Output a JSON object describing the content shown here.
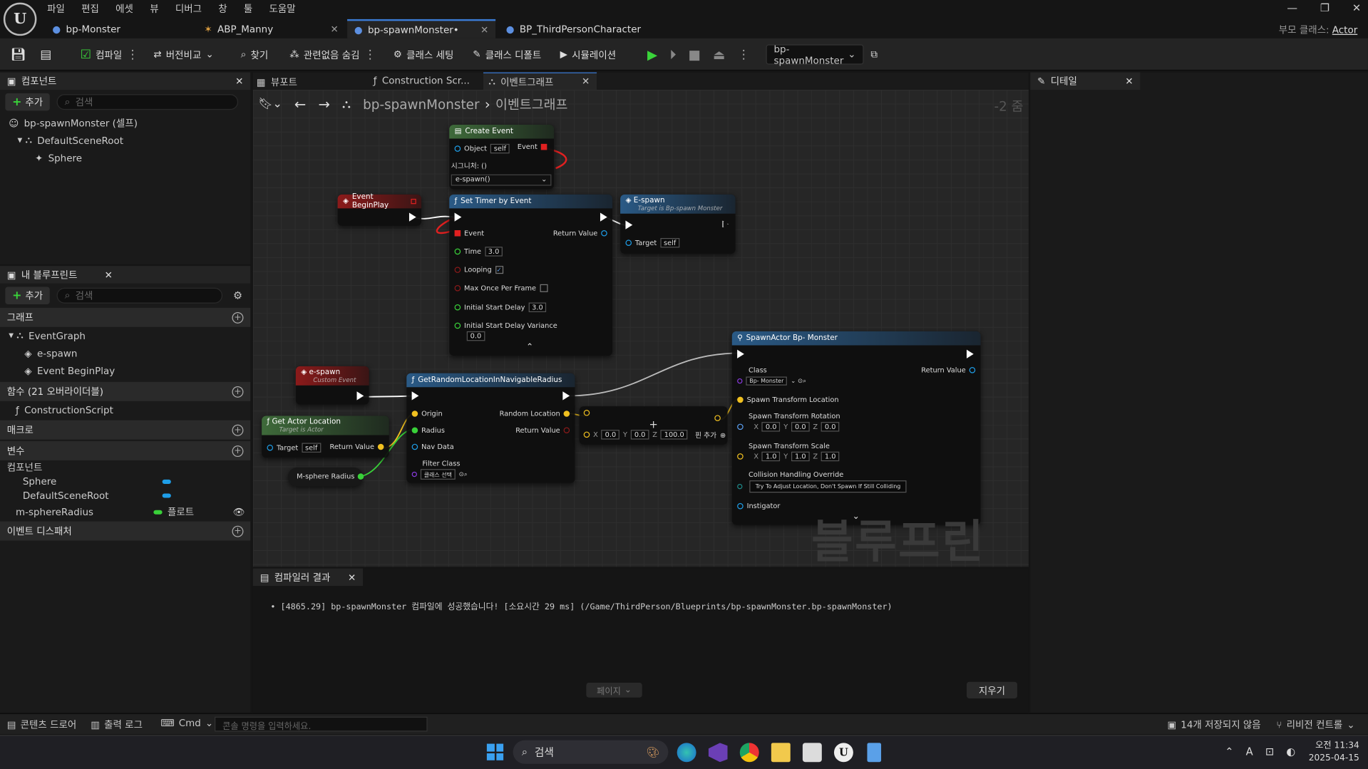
{
  "menu": [
    "파일",
    "편집",
    "에셋",
    "뷰",
    "디버그",
    "창",
    "툴",
    "도움말"
  ],
  "doc_tabs": [
    {
      "label": "bp-Monster"
    },
    {
      "label": "ABP_Manny"
    },
    {
      "label": "bp-spawnMonster•"
    },
    {
      "label": "BP_ThirdPersonCharacter"
    }
  ],
  "parent_class": {
    "label": "부모 클래스:",
    "value": "Actor"
  },
  "toolbar": {
    "compile": "컴파일",
    "diff": "버전비교",
    "find": "찾기",
    "hide_unrelated": "관련없음 숨김",
    "class_settings": "클래스 세팅",
    "class_defaults": "클래스 디폴트",
    "simulation": "시뮬레이션",
    "debug_object": "bp-spawnMonster"
  },
  "components": {
    "tab": "컴포넌트",
    "add": "추가",
    "search_placeholder": "검색",
    "items": [
      "bp-spawnMonster (셀프)",
      "DefaultSceneRoot",
      "Sphere"
    ]
  },
  "my_blueprint": {
    "tab": "내 블루프린트",
    "add": "추가",
    "search_placeholder": "검색",
    "graphs_header": "그래프",
    "event_graph": "EventGraph",
    "events": [
      "e-spawn",
      "Event BeginPlay"
    ],
    "functions_header": "함수 (21 오버라이더블)",
    "functions": [
      "ConstructionScript"
    ],
    "macros_header": "매크로",
    "variables_header": "변수",
    "components_header": "컴포넌트",
    "comp_vars": [
      "Sphere",
      "DefaultSceneRoot"
    ],
    "var_name": "m-sphereRadius",
    "var_type": "플로트",
    "dispatchers_header": "이벤트 디스패처"
  },
  "editor_tabs": [
    "뷰포트",
    "Construction Scr...",
    "이벤트그래프"
  ],
  "breadcrumb": {
    "bp": "bp-spawnMonster",
    "graph": "이벤트그래프",
    "zoom": "-2 줌"
  },
  "nodes": {
    "create_event": {
      "title": "Create Event",
      "object": "Object",
      "self": "self",
      "event": "Event",
      "signature": "시그니처: ()",
      "selected": "e-spawn()"
    },
    "begin_play": {
      "title": "Event BeginPlay"
    },
    "set_timer": {
      "title": "Set Timer by Event",
      "event": "Event",
      "return": "Return Value",
      "time": "Time",
      "time_val": "3.0",
      "looping": "Looping",
      "max_once": "Max Once Per Frame",
      "init_delay": "Initial Start Delay",
      "init_delay_val": "3.0",
      "init_var": "Initial Start Delay Variance",
      "init_var_val": "0.0"
    },
    "e_spawn_call": {
      "title": "E-spawn",
      "subtitle": "Target is Bp-spawn Monster",
      "target": "Target",
      "self": "self"
    },
    "e_spawn_custom": {
      "title": "e-spawn",
      "subtitle": "Custom Event"
    },
    "get_random": {
      "title": "GetRandomLocationInNavigableRadius",
      "origin": "Origin",
      "radius": "Radius",
      "nav_data": "Nav Data",
      "filter": "Filter Class",
      "filter_val": "클래스 선택",
      "rand_loc": "Random Location",
      "return": "Return Value"
    },
    "get_actor_loc": {
      "title": "Get Actor Location",
      "subtitle": "Target is Actor",
      "target": "Target",
      "self": "self",
      "return": "Return Value"
    },
    "sphere_radius": {
      "title": "M-sphere Radius"
    },
    "add_vec": {
      "x": "0.0",
      "y": "0.0",
      "z": "100.0",
      "add_pin": "핀 추가"
    },
    "spawn": {
      "title": "SpawnActor Bp- Monster",
      "class": "Class",
      "class_val": "Bp- Monster",
      "return": "Return Value",
      "loc": "Spawn Transform Location",
      "rot": "Spawn Transform Rotation",
      "rx": "0.0",
      "ry": "0.0",
      "rz": "0.0",
      "scale": "Spawn Transform Scale",
      "sx": "1.0",
      "sy": "1.0",
      "sz": "1.0",
      "collision": "Collision Handling Override",
      "collision_val": "Try To Adjust Location, Don't Spawn If Still Colliding",
      "instigator": "Instigator"
    }
  },
  "watermark": "블루프린트",
  "compiler": {
    "tab": "컴파일러 결과",
    "message": "[4865.29] bp-spawnMonster 컴파일에 성공했습니다! [소요시간 29 ms] (/Game/ThirdPerson/Blueprints/bp-spawnMonster.bp-spawnMonster)",
    "page": "페이지",
    "clear": "지우기"
  },
  "details": {
    "tab": "디테일"
  },
  "statusbar": {
    "content_drawer": "콘텐츠 드로어",
    "output_log": "출력 로그",
    "cmd": "Cmd",
    "console_placeholder": "콘솔 명령을 입력하세요.",
    "unsaved": "14개 저장되지 않음",
    "revision": "리비전 컨트롤"
  },
  "taskbar": {
    "search": "검색",
    "time": "오전 11:34",
    "date": "2025-04-15"
  },
  "colors": {
    "accent": "#3a7bd5",
    "event_head": "#8b1a1a",
    "func_head": "#2a5a86",
    "pure_head": "#3e6a3a"
  }
}
